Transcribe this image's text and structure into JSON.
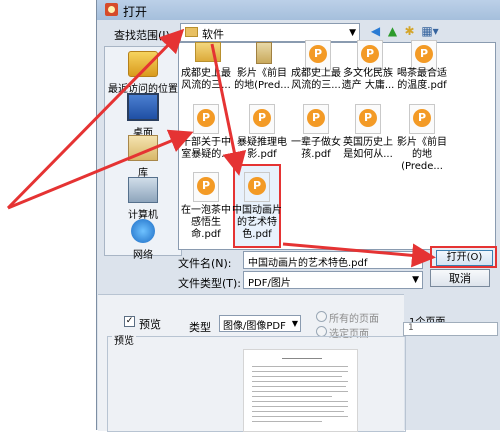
{
  "window": {
    "title": "打开"
  },
  "toolbar": {
    "look_in_label": "查找范围(I):",
    "current_folder": "软件",
    "back_icon": "back-icon",
    "up_icon": "up-folder-icon",
    "new_folder_icon": "new-folder-icon",
    "view_icon": "view-menu-icon"
  },
  "places": [
    {
      "label": "最近访问的位置",
      "icon": "recent-places-icon"
    },
    {
      "label": "桌面",
      "icon": "desktop-icon"
    },
    {
      "label": "库",
      "icon": "library-icon"
    },
    {
      "label": "计算机",
      "icon": "computer-icon"
    },
    {
      "label": "网络",
      "icon": "network-icon"
    }
  ],
  "files": [
    {
      "name": "",
      "kind": "folder"
    },
    {
      "name": "",
      "kind": "folder"
    },
    {
      "name": "",
      "kind": "pdf"
    },
    {
      "name": "",
      "kind": "pdf"
    },
    {
      "name": "",
      "kind": "pdf"
    },
    {
      "name": "成都史上最风流的三...",
      "kind": "pdf"
    },
    {
      "name": "影片《前目的地(Pred...",
      "kind": "pdf"
    },
    {
      "name": "成都史上最风流的三...",
      "kind": "pdf"
    },
    {
      "name": "多文化民族遗产 大庸...",
      "kind": "pdf"
    },
    {
      "name": "喝茶最合适的温度.pdf",
      "kind": "pdf"
    },
    {
      "name": "十部关于中室暴疑的...",
      "kind": "pdf"
    },
    {
      "name": "暴疑推理电影.pdf",
      "kind": "pdf"
    },
    {
      "name": "一辈子做女孩.pdf",
      "kind": "pdf"
    },
    {
      "name": "英国历史上是如何从...",
      "kind": "pdf"
    },
    {
      "name": "影片《前目的地(Prede...",
      "kind": "pdf"
    },
    {
      "name": "在一泡茶中感悟生命.pdf",
      "kind": "pdf"
    },
    {
      "name": "中国动画片的艺术特色.pdf",
      "kind": "pdf",
      "selected": true
    }
  ],
  "filename": {
    "label": "文件名(N):",
    "value": "中国动画片的艺术特色.pdf"
  },
  "filetype": {
    "label": "文件类型(T):",
    "value": "PDF/图片"
  },
  "buttons": {
    "open": "打开(O)",
    "cancel": "取消"
  },
  "preview": {
    "checkbox_label": "预览",
    "checked": true,
    "type_label": "类型",
    "type_value": "图像/图像PDF",
    "all_pages": "所有的页面",
    "selected_pages": "选定页面",
    "page_count": "1个页面",
    "page_input": "1",
    "group_label": "预览"
  },
  "colors": {
    "annotation_red": "#e53333",
    "pdf_orange": "#f39a25"
  }
}
